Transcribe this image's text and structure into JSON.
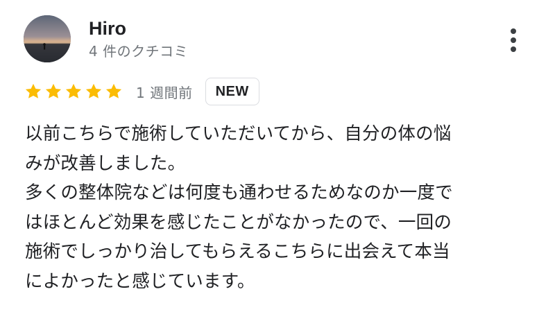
{
  "review": {
    "author": {
      "name": "Hiro",
      "review_count_label": "4 件のクチコミ",
      "avatar_icon": "sunset-beach-photo"
    },
    "more_icon": "more-vert-icon",
    "rating": {
      "stars": 5,
      "max_stars": 5,
      "star_color": "#fbbc04",
      "star_icon": "star-icon"
    },
    "time_ago": "1 週間前",
    "badge": "NEW",
    "body": "以前こちらで施術していただいてから、自分の体の悩\nみが改善しました。\n多くの整体院などは何度も通わせるためなのか一度で\nはほとんど効果を感じたことがなかったので、一回の\n施術でしっかり治してもらえるこちらに出会えて本当\nによかったと感じています。"
  }
}
